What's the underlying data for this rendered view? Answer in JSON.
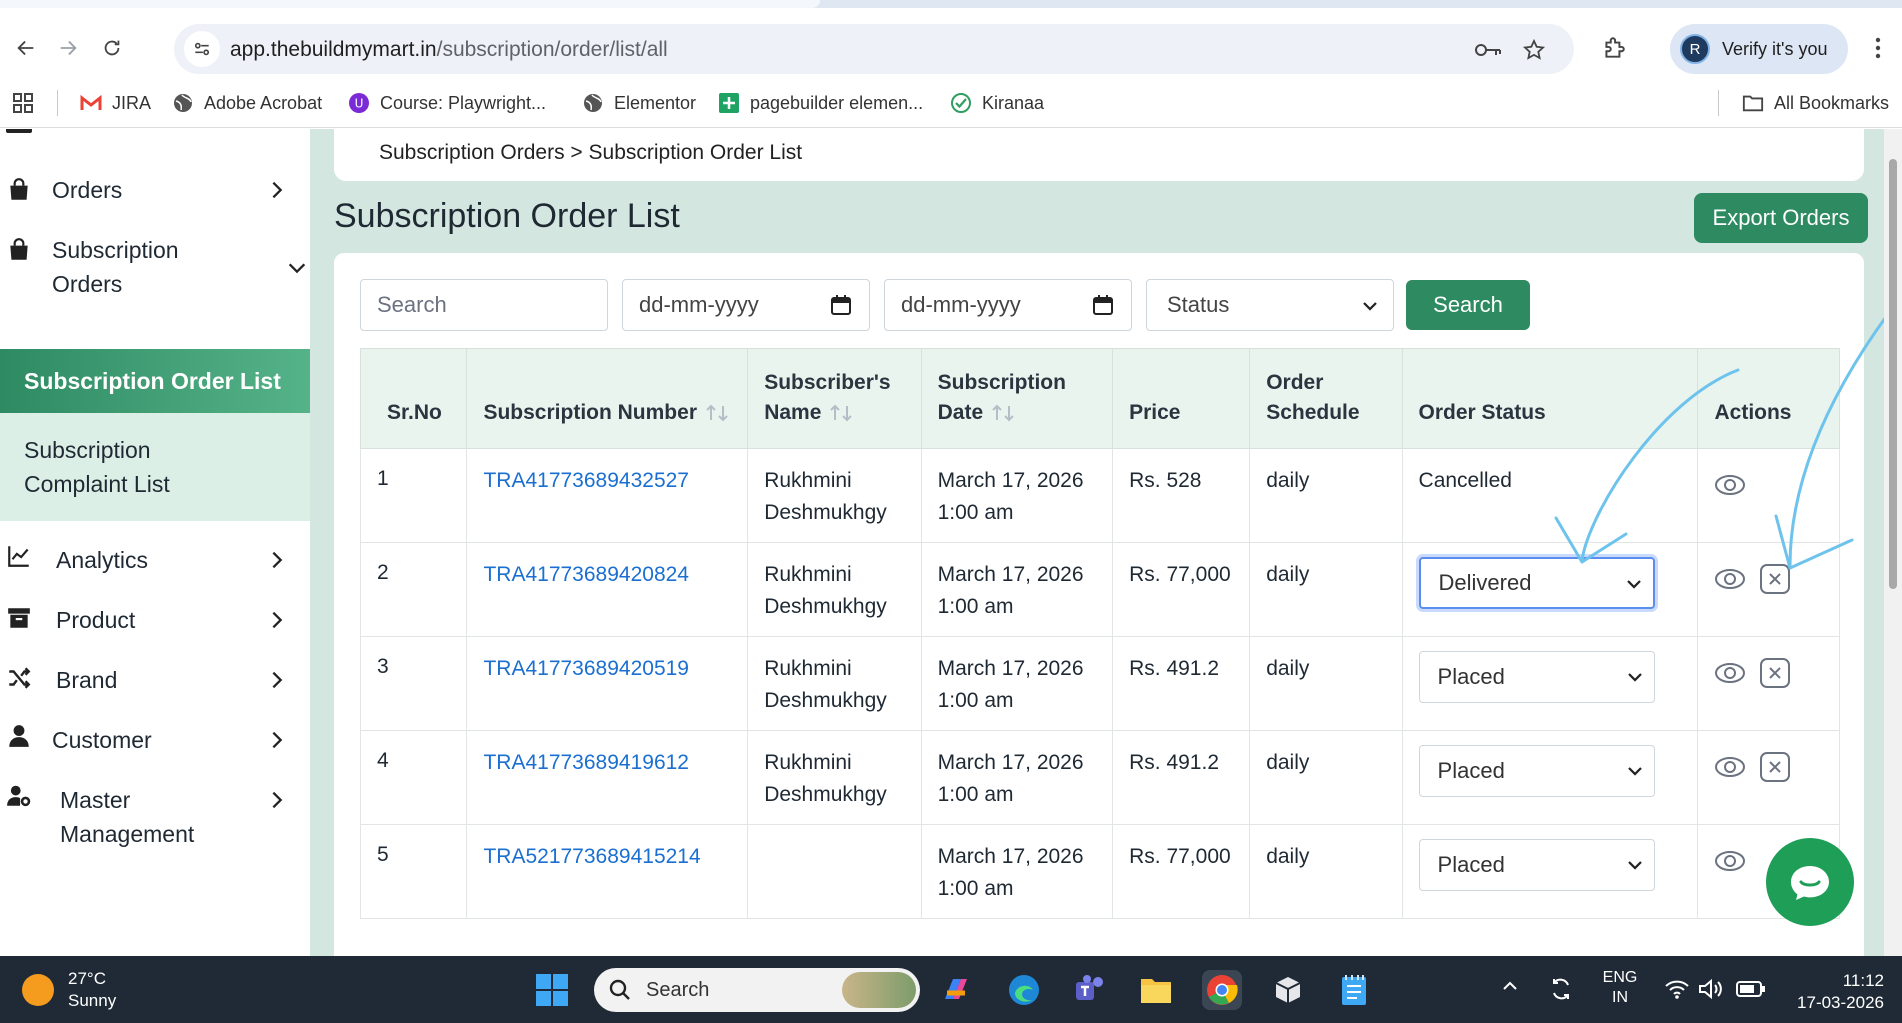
{
  "browser": {
    "url_host": "app.thebuildmymart.in",
    "url_path": "/subscription/order/list/all",
    "profile_initial": "R",
    "verify_label": "Verify it's you",
    "bookmarks": [
      "JIRA",
      "Adobe Acrobat",
      "Course: Playwright...",
      "Elementor",
      "pagebuilder elemen...",
      "Kiranaa"
    ],
    "all_bookmarks": "All Bookmarks"
  },
  "sidebar": {
    "items": [
      {
        "label": "Orders",
        "icon": "bag-icon"
      },
      {
        "label": "Subscription Orders",
        "icon": "bag-icon"
      },
      {
        "label": "Subscription Order List"
      },
      {
        "label": "Subscription Complaint List"
      },
      {
        "label": "Analytics",
        "icon": "chart-icon"
      },
      {
        "label": "Product",
        "icon": "archive-icon"
      },
      {
        "label": "Brand",
        "icon": "shuffle-icon"
      },
      {
        "label": "Customer",
        "icon": "user-icon"
      },
      {
        "label": "Master Management",
        "icon": "user-cog-icon"
      }
    ]
  },
  "main": {
    "breadcrumb": "Subscription Orders > Subscription Order List",
    "title": "Subscription Order List",
    "export_label": "Export Orders",
    "filters": {
      "search_placeholder": "Search",
      "date_from": "dd-mm-yyyy",
      "date_to": "dd-mm-yyyy",
      "status": "Status",
      "search_button": "Search"
    },
    "table": {
      "headers": [
        "Sr.No",
        "Subscription Number",
        "Subscriber's Name",
        "Subscription Date",
        "Price",
        "Order Schedule",
        "Order Status",
        "Actions"
      ],
      "rows": [
        {
          "sr": "1",
          "number": "TRA41773689432527",
          "name": "Rukhmini Deshmukhgy",
          "date": "March 17, 2026 1:00 am",
          "price": "Rs. 528",
          "schedule": "daily",
          "status": "Cancelled"
        },
        {
          "sr": "2",
          "number": "TRA41773689420824",
          "name": "Rukhmini Deshmukhgy",
          "date": "March 17, 2026 1:00 am",
          "price": "Rs. 77,000",
          "schedule": "daily",
          "status": "Delivered"
        },
        {
          "sr": "3",
          "number": "TRA41773689420519",
          "name": "Rukhmini Deshmukhgy",
          "date": "March 17, 2026 1:00 am",
          "price": "Rs. 491.2",
          "schedule": "daily",
          "status": "Placed"
        },
        {
          "sr": "4",
          "number": "TRA41773689419612",
          "name": "Rukhmini Deshmukhgy",
          "date": "March 17, 2026 1:00 am",
          "price": "Rs. 491.2",
          "schedule": "daily",
          "status": "Placed"
        },
        {
          "sr": "5",
          "number": "TRA521773689415214",
          "name": "",
          "date": "March 17, 2026 1:00 am",
          "price": "Rs. 77,000",
          "schedule": "daily",
          "status": "Placed"
        }
      ]
    }
  },
  "taskbar": {
    "temperature": "27°C",
    "weather": "Sunny",
    "search": "Search",
    "lang_top": "ENG",
    "lang_bottom": "IN",
    "time": "11:12",
    "date": "17-03-2026"
  },
  "colors": {
    "accent": "#2d8a61",
    "main_bg": "#d3e6df",
    "link": "#1a6fd1",
    "annotation": "#6ec3ec"
  }
}
